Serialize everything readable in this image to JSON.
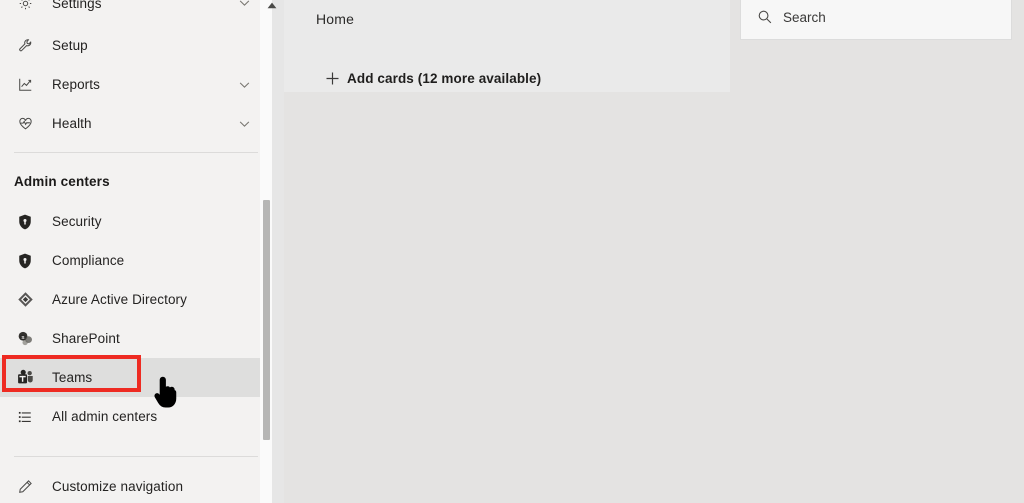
{
  "sidebar": {
    "items_top": [
      {
        "label": "Settings",
        "icon": "gear-icon",
        "chevron": true
      },
      {
        "label": "Setup",
        "icon": "wrench-icon",
        "chevron": false
      },
      {
        "label": "Reports",
        "icon": "chart-icon",
        "chevron": true
      },
      {
        "label": "Health",
        "icon": "heart-pulse-icon",
        "chevron": true
      }
    ],
    "section_title": "Admin centers",
    "admin_centers": [
      {
        "label": "Security",
        "icon": "shield-lock-icon"
      },
      {
        "label": "Compliance",
        "icon": "shield-lock-icon"
      },
      {
        "label": "Azure Active Directory",
        "icon": "azure-ad-icon"
      },
      {
        "label": "SharePoint",
        "icon": "sharepoint-icon"
      },
      {
        "label": "Teams",
        "icon": "teams-icon"
      },
      {
        "label": "All admin centers",
        "icon": "list-icon"
      }
    ],
    "footer": {
      "label": "Customize navigation",
      "icon": "pencil-icon"
    },
    "scroll_up_icon": "scroll-up-arrow-icon"
  },
  "main": {
    "page_title": "Home",
    "add_cards_label": "Add cards (12 more available)",
    "add_cards_icon": "plus-icon"
  },
  "search": {
    "placeholder": "Search",
    "value": "",
    "icon": "search-icon"
  },
  "annotation": {
    "highlight_target": "Teams",
    "highlight_color": "#ee2b22",
    "cursor": "pointing-hand-cursor"
  },
  "colors": {
    "sidebar_bg": "#f3f2f1",
    "main_bg": "#e4e3e2",
    "panel_bg": "#eaeaea",
    "hover_bg": "#dededd",
    "accent_red": "#ee2b22"
  }
}
